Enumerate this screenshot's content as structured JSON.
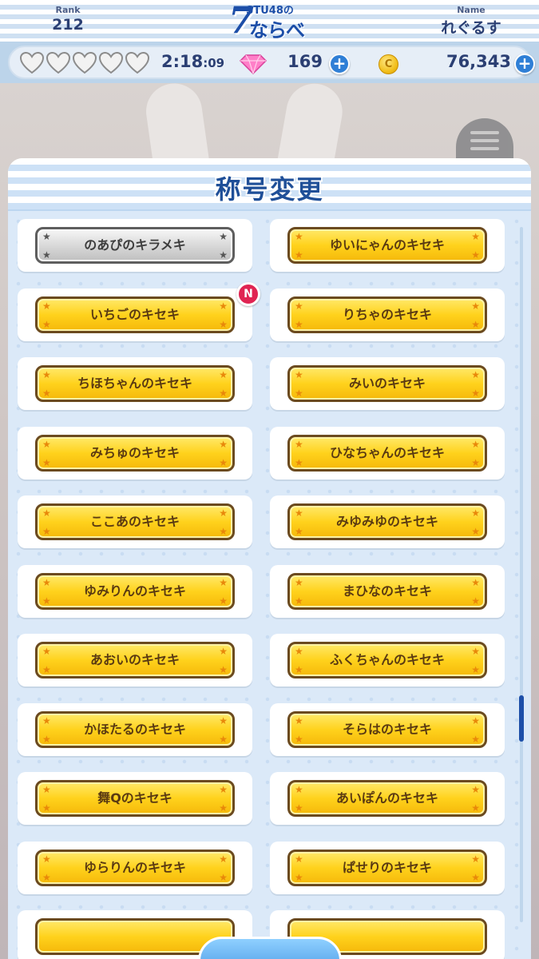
{
  "header": {
    "rank_label": "Rank",
    "rank_value": "212",
    "logo_sub": "STU48の",
    "logo_number": "7",
    "logo_main": "ならべ",
    "name_label": "Name",
    "name_value": "れぐるす"
  },
  "status": {
    "hearts_full": 0,
    "hearts_total": 5,
    "timer_main": "2:18",
    "timer_seconds": ":09",
    "gems": "169",
    "coins": "76,343",
    "plus_label": "+",
    "coin_glyph": "C"
  },
  "dialog": {
    "title": "称号変更",
    "titles": [
      {
        "label": "のあぴのキラメキ",
        "style": "silver",
        "is_new": false
      },
      {
        "label": "ゆいにゃんのキセキ",
        "style": "gold",
        "is_new": false
      },
      {
        "label": "いちごのキセキ",
        "style": "gold",
        "is_new": true
      },
      {
        "label": "りちゃのキセキ",
        "style": "gold",
        "is_new": false
      },
      {
        "label": "ちほちゃんのキセキ",
        "style": "gold",
        "is_new": false
      },
      {
        "label": "みいのキセキ",
        "style": "gold",
        "is_new": false
      },
      {
        "label": "みちゅのキセキ",
        "style": "gold",
        "is_new": false
      },
      {
        "label": "ひなちゃんのキセキ",
        "style": "gold",
        "is_new": false
      },
      {
        "label": "ここあのキセキ",
        "style": "gold",
        "is_new": false
      },
      {
        "label": "みゆみゆのキセキ",
        "style": "gold",
        "is_new": false
      },
      {
        "label": "ゆみりんのキセキ",
        "style": "gold",
        "is_new": false
      },
      {
        "label": "まひなのキセキ",
        "style": "gold",
        "is_new": false
      },
      {
        "label": "あおいのキセキ",
        "style": "gold",
        "is_new": false
      },
      {
        "label": "ふくちゃんのキセキ",
        "style": "gold",
        "is_new": false
      },
      {
        "label": "かほたるのキセキ",
        "style": "gold",
        "is_new": false
      },
      {
        "label": "そらはのキセキ",
        "style": "gold",
        "is_new": false
      },
      {
        "label": "舞Qのキセキ",
        "style": "gold",
        "is_new": false
      },
      {
        "label": "あいぽんのキセキ",
        "style": "gold",
        "is_new": false
      },
      {
        "label": "ゆらりんのキセキ",
        "style": "gold",
        "is_new": false
      },
      {
        "label": "ぱせりのキセキ",
        "style": "gold",
        "is_new": false
      }
    ],
    "new_badge": "N",
    "scroll_position": 0.8
  },
  "icons": {
    "heart": "heart-icon",
    "gem": "gem-icon",
    "coin": "coin-icon",
    "menu": "hamburger-menu-icon",
    "star": "star-icon"
  },
  "colors": {
    "title_blue": "#1f4f98",
    "plate_gold": "#ffd21c",
    "plate_border": "#6b4a1f",
    "new_badge": "#e02452",
    "plus_button": "#2f7fd6"
  }
}
